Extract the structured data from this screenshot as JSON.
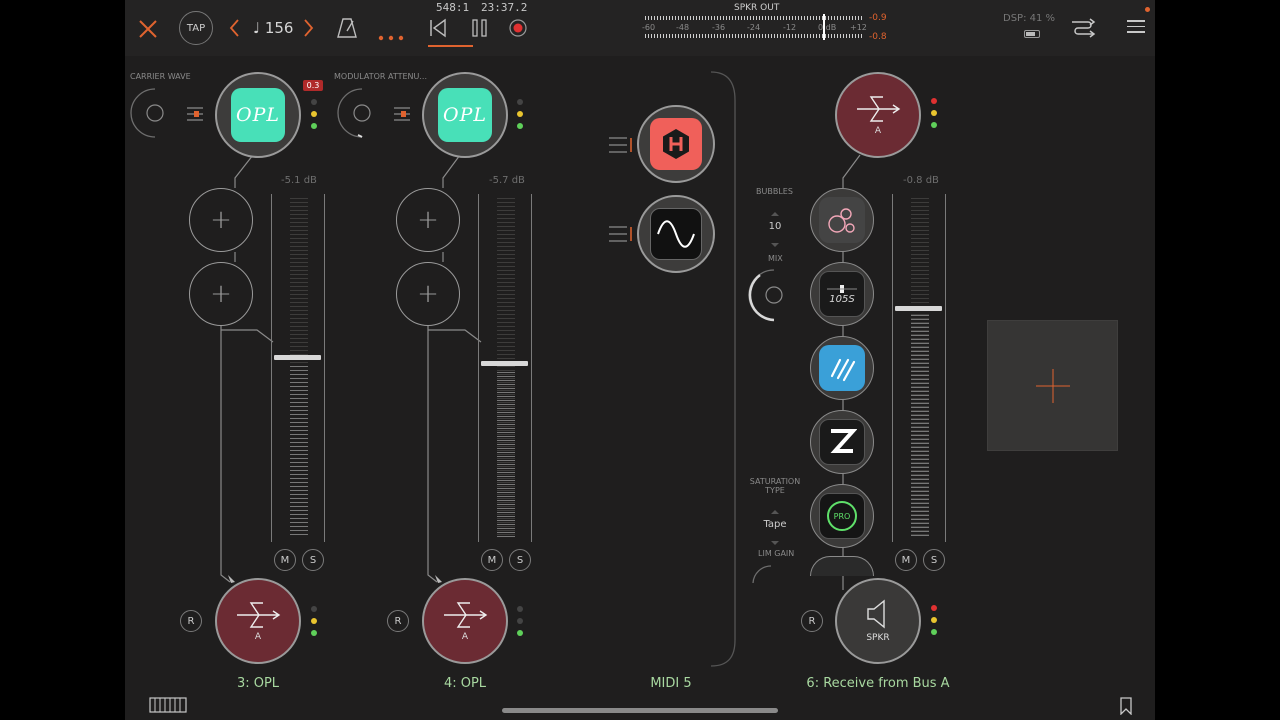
{
  "topbar": {
    "tap_label": "TAP",
    "tempo": "♩ 156",
    "position": "548:1",
    "time": "23:37.2",
    "speaker_out_label": "SPKR OUT",
    "meter_ticks": [
      "-60",
      "-48",
      "-36",
      "-24",
      "-12",
      "0 dB",
      "+12"
    ],
    "peak_left": "-0.9",
    "peak_right": "-0.8",
    "dsp": "DSP: 41 %"
  },
  "channels": [
    {
      "param_label": "CARRIER WAVE",
      "plugin_text": "OPL",
      "clip_badge": "0.3",
      "db": "-5.1 dB",
      "mute": "M",
      "solo": "S",
      "record": "R",
      "bus_letter": "A",
      "name": "3: OPL",
      "fader_level_percent": 48
    },
    {
      "param_label": "MODULATOR ATTENU...",
      "plugin_text": "OPL",
      "db": "-5.7 dB",
      "mute": "M",
      "solo": "S",
      "record": "R",
      "bus_letter": "A",
      "name": "4: OPL",
      "fader_level_percent": 46
    },
    {
      "name": "MIDI 5"
    },
    {
      "receive_letter": "A",
      "db": "-0.8 dB",
      "mute": "M",
      "solo": "S",
      "record": "R",
      "output_label": "SPKR",
      "name": "6: Receive from Bus A",
      "fader_level_percent": 71
    }
  ],
  "params": {
    "bubbles_label": "BUBBLES",
    "bubbles_value": "10",
    "mix_label": "MIX",
    "saturation_label_1": "SATURATION",
    "saturation_label_2": "TYPE",
    "saturation_value": "Tape",
    "lim_gain_label": "LIM GAIN"
  },
  "fx_chain": {
    "tape_text": "105S",
    "pro_text": "PRO"
  },
  "colors": {
    "accent_orange": "#e0632f",
    "opl_teal": "#48e0b8",
    "bus_red": "#6b2b33",
    "label_green": "#a8d8a0"
  }
}
